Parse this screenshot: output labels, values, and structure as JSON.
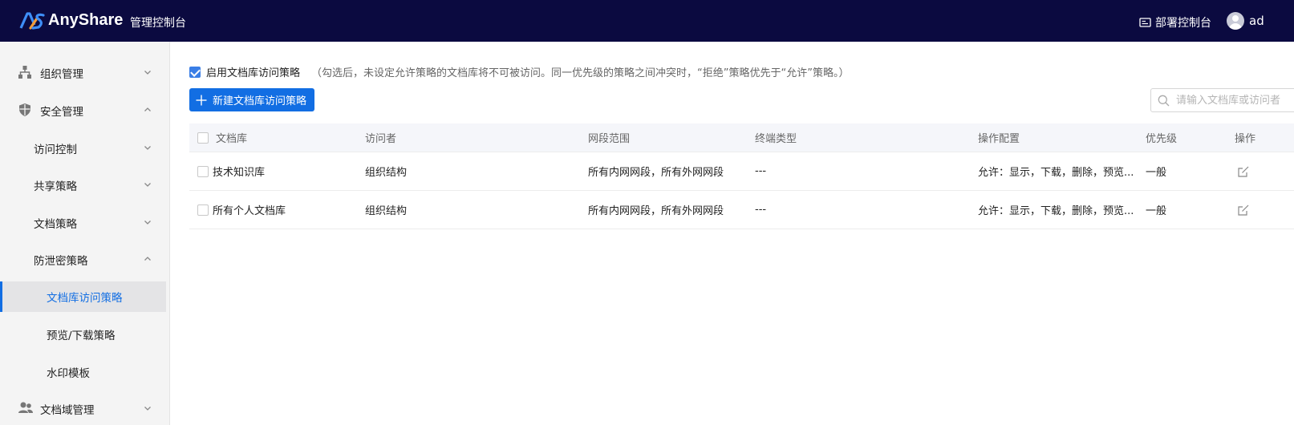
{
  "header": {
    "brand": "AnyShare",
    "console_title": "管理控制台",
    "deploy_label": "部署控制台",
    "user_name": "ad"
  },
  "sidebar": {
    "items": [
      {
        "label": "组织管理",
        "icon": "org-structure-icon",
        "expanded": false
      },
      {
        "label": "安全管理",
        "icon": "shield-icon",
        "expanded": true
      },
      {
        "label": "访问控制",
        "expanded": false
      },
      {
        "label": "共享策略",
        "expanded": false
      },
      {
        "label": "文档策略",
        "expanded": false
      },
      {
        "label": "防泄密策略",
        "expanded": true
      },
      {
        "label": "文档库访问策略",
        "active": true
      },
      {
        "label": "预览/下载策略"
      },
      {
        "label": "水印模板"
      },
      {
        "label": "文档域管理",
        "icon": "users-icon",
        "expanded": false
      }
    ]
  },
  "main": {
    "enable_label": "启用文档库访问策略",
    "enable_checked": true,
    "enable_hint": "（勾选后，未设定允许策略的文档库将不可被访问。同一优先级的策略之间冲突时，“拒绝”策略优先于“允许”策略。）",
    "new_button_label": "新建文档库访问策略",
    "search_placeholder": "请输入文档库或访问者",
    "table": {
      "headers": [
        "文档库",
        "访问者",
        "网段范围",
        "终端类型",
        "操作配置",
        "优先级",
        "操作"
      ],
      "rows": [
        [
          "技术知识库",
          "组织结构",
          "所有内网网段，所有外网网段",
          "---",
          "允许：显示，下载，删除，预览...",
          "一般"
        ],
        [
          "所有个人文档库",
          "组织结构",
          "所有内网网段，所有外网网段",
          "---",
          "允许：显示，下载，删除，预览...",
          "一般"
        ]
      ]
    }
  },
  "colors": {
    "topbar": "#0b0a40",
    "accent": "#126ee3",
    "sidebar_bg": "#f4f4f4"
  }
}
